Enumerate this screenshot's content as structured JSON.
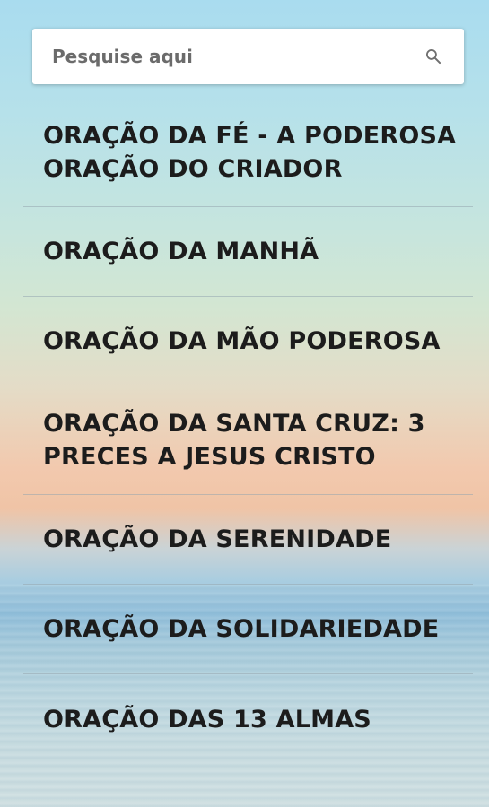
{
  "search": {
    "placeholder": "Pesquise aqui",
    "icon": "search-icon"
  },
  "prayers": [
    "ORAÇÃO DA FÉ - A PODEROSA ORAÇÃO DO CRIADOR",
    "ORAÇÃO DA MANHÃ",
    "ORAÇÃO DA MÃO PODEROSA",
    "ORAÇÃO DA SANTA CRUZ: 3 PRECES A JESUS CRISTO",
    "ORAÇÃO DA SERENIDADE",
    "ORAÇÃO DA SOLIDARIEDADE",
    "ORAÇÃO DAS 13 ALMAS"
  ]
}
